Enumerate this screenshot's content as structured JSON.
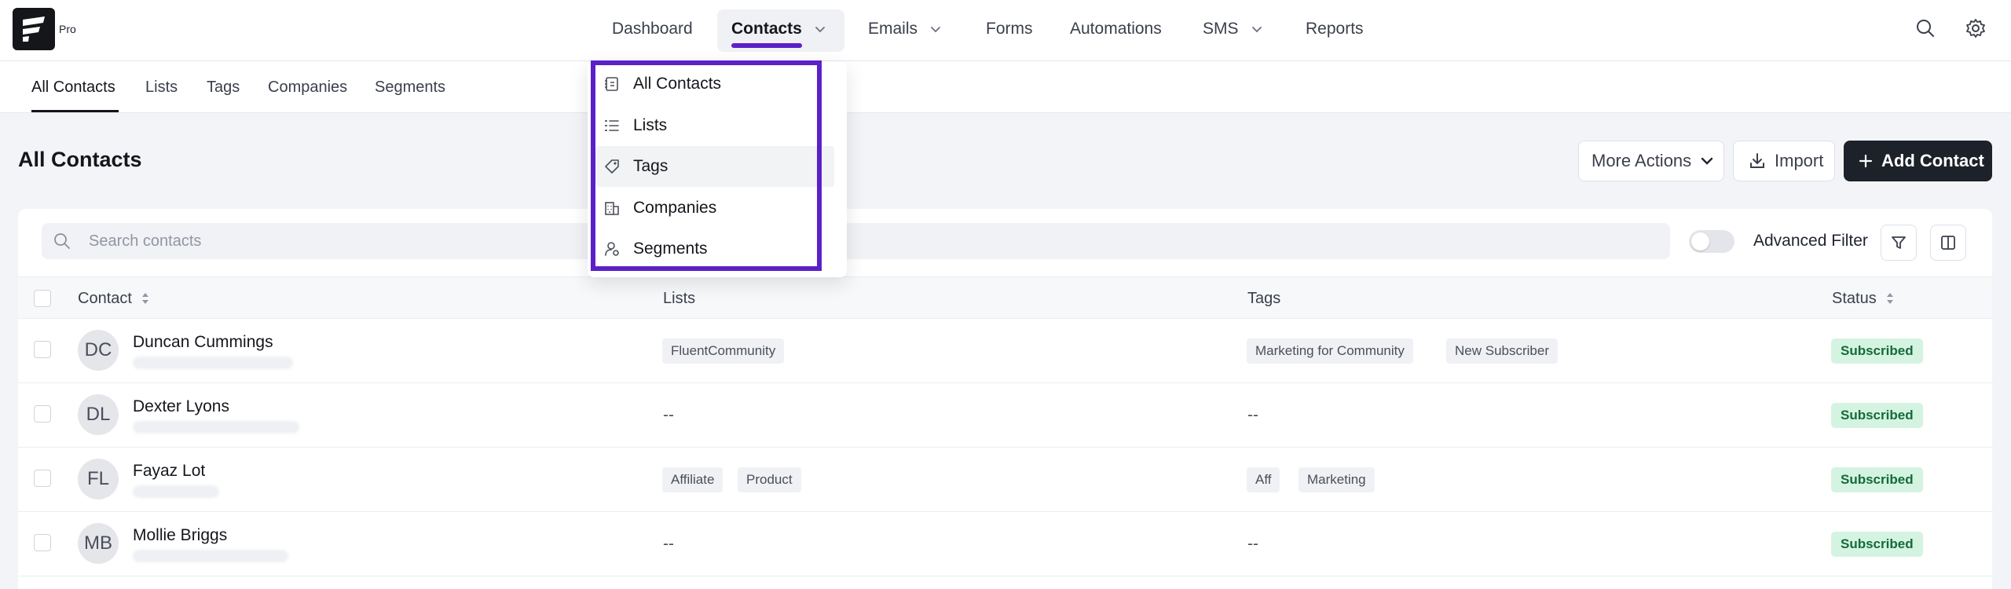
{
  "brand": {
    "badge": "Pro"
  },
  "nav": {
    "items": [
      {
        "label": "Dashboard"
      },
      {
        "label": "Contacts"
      },
      {
        "label": "Emails"
      },
      {
        "label": "Forms"
      },
      {
        "label": "Automations"
      },
      {
        "label": "SMS"
      },
      {
        "label": "Reports"
      }
    ],
    "icons": [
      "search-icon",
      "settings-icon"
    ]
  },
  "subnav": {
    "items": [
      {
        "label": "All Contacts"
      },
      {
        "label": "Lists"
      },
      {
        "label": "Tags"
      },
      {
        "label": "Companies"
      },
      {
        "label": "Segments"
      }
    ]
  },
  "dropdown": {
    "items": [
      {
        "label": "All Contacts",
        "icon": "contacts-book-icon"
      },
      {
        "label": "Lists",
        "icon": "list-icon"
      },
      {
        "label": "Tags",
        "icon": "tag-icon"
      },
      {
        "label": "Companies",
        "icon": "building-icon"
      },
      {
        "label": "Segments",
        "icon": "user-segment-icon"
      }
    ],
    "highlight_color": "#5b21c9"
  },
  "page": {
    "title": "All Contacts",
    "more_actions_label": "More Actions",
    "import_label": "Import",
    "add_contact_label": "Add Contact"
  },
  "filters": {
    "search_placeholder": "Search contacts",
    "advanced_filter_label": "Advanced Filter",
    "advanced_filter_on": false
  },
  "table": {
    "columns": [
      "Contact",
      "Lists",
      "Tags",
      "Status"
    ],
    "rows": [
      {
        "initials": "DC",
        "name": "Duncan Cummings",
        "lists": [
          "FluentCommunity"
        ],
        "tags": [
          "Marketing for Community",
          "New Subscriber"
        ],
        "status": "Subscribed"
      },
      {
        "initials": "DL",
        "name": "Dexter Lyons",
        "lists_empty": "--",
        "tags_empty": "--",
        "status": "Subscribed"
      },
      {
        "initials": "FL",
        "name": "Fayaz Lot",
        "lists": [
          "Affiliate",
          "Product"
        ],
        "tags": [
          "Aff",
          "Marketing"
        ],
        "status": "Subscribed"
      },
      {
        "initials": "MB",
        "name": "Mollie Briggs",
        "lists_empty": "--",
        "tags_empty": "--",
        "status": "Subscribed"
      }
    ]
  },
  "colors": {
    "accent": "#5b21c9",
    "primary_button": "#1d2129",
    "status_subscribed_bg": "#d4f4e1",
    "status_subscribed_text": "#166a3b"
  }
}
